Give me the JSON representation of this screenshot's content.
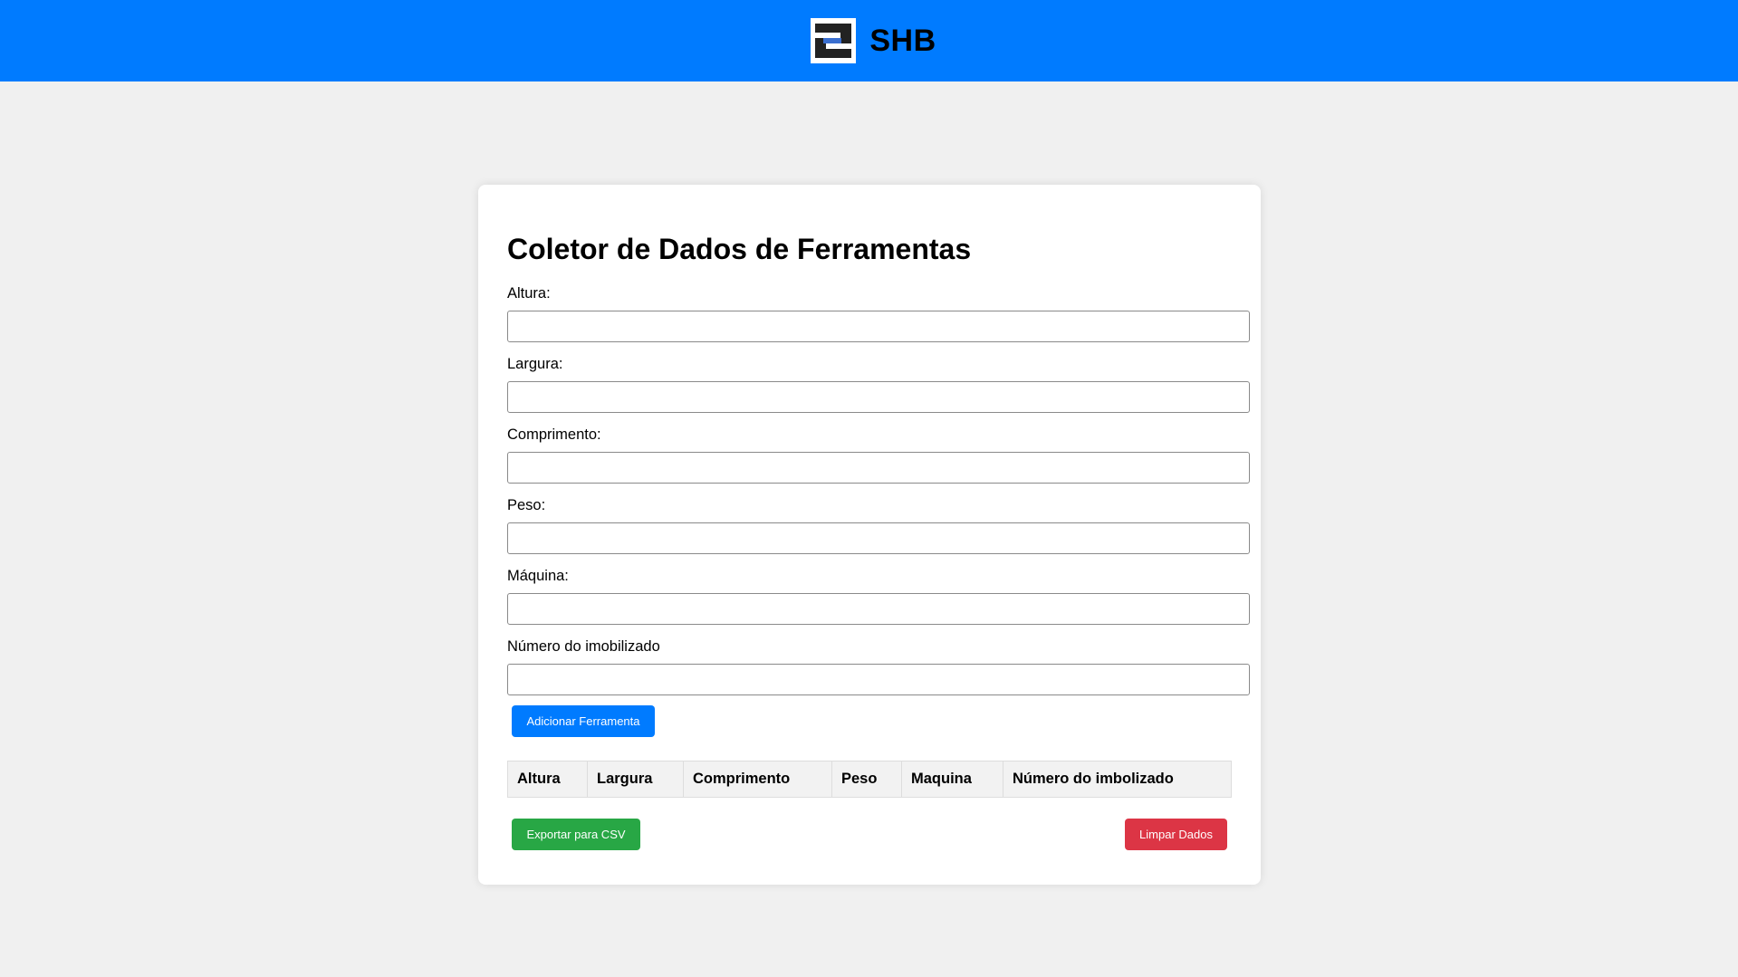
{
  "header": {
    "brand_name": "SHB",
    "logo_icon": "shb-logo-icon",
    "background": "#007bff"
  },
  "form": {
    "title": "Coletor de Dados de Ferramentas",
    "fields": [
      {
        "label": "Altura:",
        "value": ""
      },
      {
        "label": "Largura:",
        "value": ""
      },
      {
        "label": "Comprimento:",
        "value": ""
      },
      {
        "label": "Peso:",
        "value": ""
      },
      {
        "label": "Máquina:",
        "value": ""
      },
      {
        "label": "Número do imobilizado",
        "value": ""
      }
    ],
    "add_button_label": "Adicionar Ferramenta"
  },
  "table": {
    "columns": [
      "Altura",
      "Largura",
      "Comprimento",
      "Peso",
      "Maquina",
      "Número do imbolizado"
    ],
    "rows": []
  },
  "actions": {
    "export_label": "Exportar para CSV",
    "clear_label": "Limpar Dados"
  },
  "colors": {
    "primary": "#007bff",
    "success": "#28a745",
    "danger": "#dc3545",
    "page_bg": "#f0f0f0"
  }
}
